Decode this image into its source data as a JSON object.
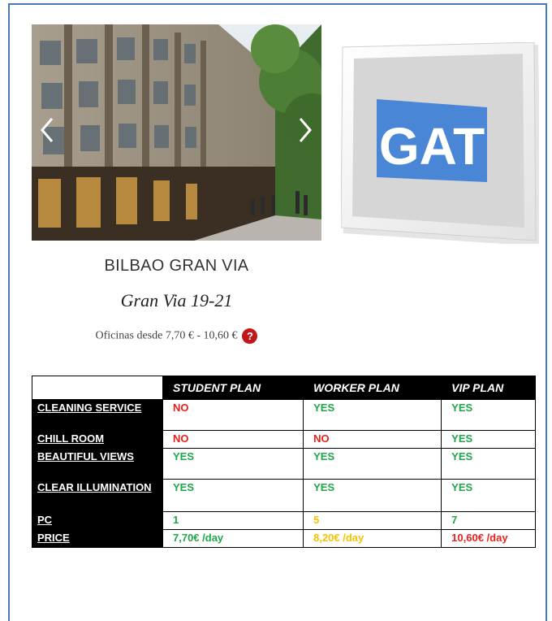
{
  "listing": {
    "title": "BILBAO GRAN VIA",
    "address": "Gran Via 19-21",
    "price_text": "Oficinas desde 7,70 € - 10,60 €",
    "help_label": "?"
  },
  "logo": {
    "text": "GAT",
    "color": "#4a86d6"
  },
  "table": {
    "columns": [
      "STUDENT PLAN",
      "WORKER PLAN",
      "VIP PLAN"
    ],
    "rows": [
      {
        "label": "CLEANING SERVICE",
        "values": [
          "NO",
          "YES",
          "YES"
        ]
      },
      {
        "label": "CHILL ROOM",
        "values": [
          "NO",
          "NO",
          "YES"
        ]
      },
      {
        "label": "BEAUTIFUL VIEWS",
        "values": [
          "YES",
          "YES",
          "YES"
        ]
      },
      {
        "label": "CLEAR ILLUMINATION",
        "values": [
          "YES",
          "YES",
          "YES"
        ]
      },
      {
        "label": "PC",
        "values": [
          "1",
          "5",
          "7"
        ]
      },
      {
        "label": "PRICE",
        "values": [
          "7,70€ /day",
          "8,20€ /day",
          "10,60€ /day"
        ]
      }
    ]
  },
  "colors": {
    "frame": "#4a7bb0",
    "no": "#e8211e",
    "yes": "#1fa74a",
    "mid": "#f5c200",
    "badge": "#c0171c"
  }
}
